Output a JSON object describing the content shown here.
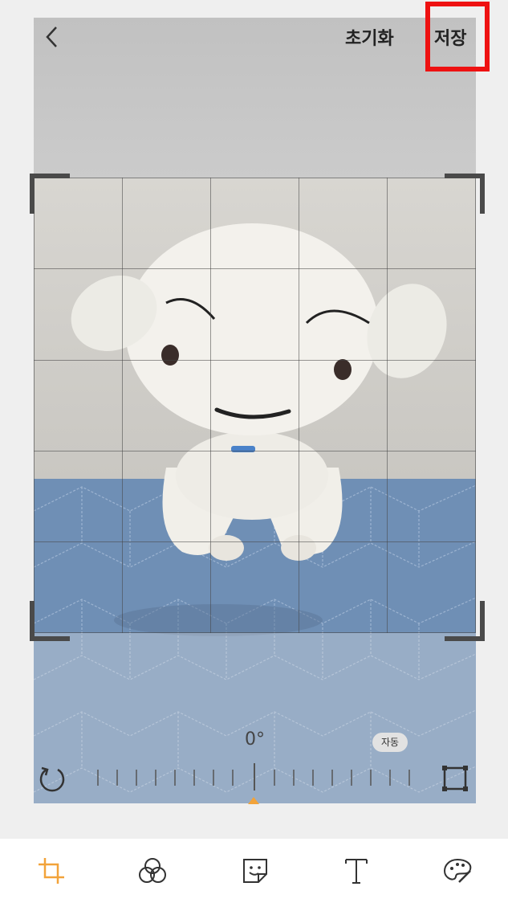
{
  "header": {
    "back_icon": "chevron-left-icon",
    "reset_label": "초기화",
    "save_label": "저장"
  },
  "editor": {
    "rotation_angle": "0°",
    "auto_label": "자동",
    "accent_color": "#f2a33a",
    "highlight_color": "#ee1111"
  },
  "toolbar": {
    "items": [
      {
        "icon": "crop-icon",
        "active": true
      },
      {
        "icon": "filter-icon",
        "active": false
      },
      {
        "icon": "sticker-icon",
        "active": false
      },
      {
        "icon": "text-icon",
        "active": false
      },
      {
        "icon": "palette-icon",
        "active": false
      }
    ]
  }
}
